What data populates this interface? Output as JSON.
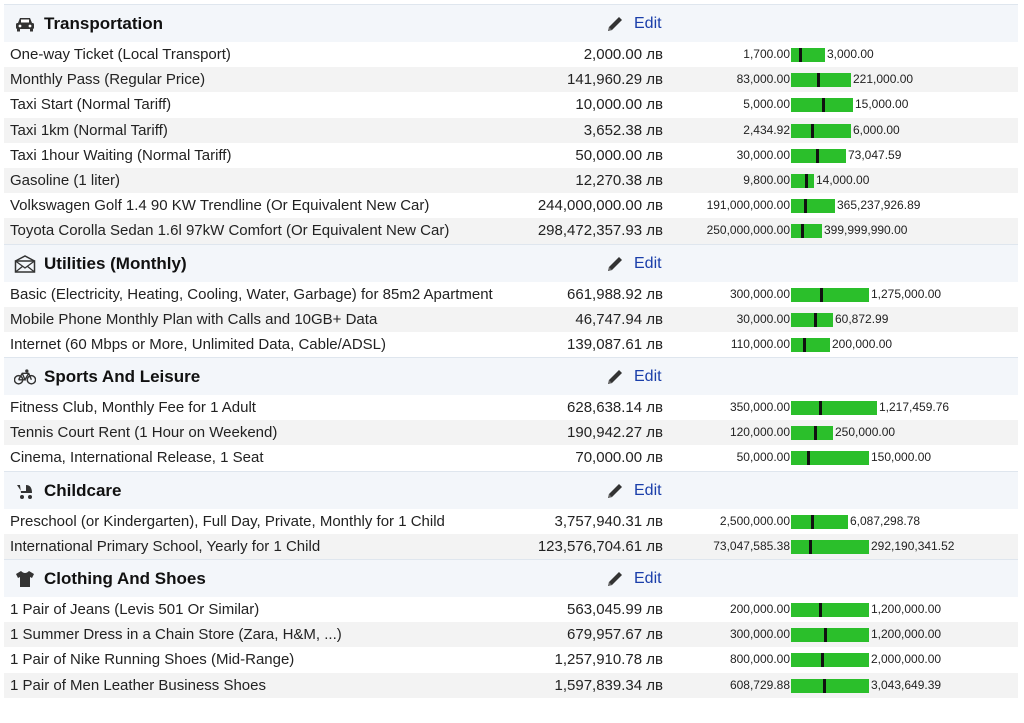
{
  "edit_label": "Edit",
  "colors": {
    "bar": "#2bbf2b",
    "edit_link": "#1a3eaa",
    "header_bg": "#f3f6fa"
  },
  "sections": [
    {
      "title": "Transportation",
      "icon": "car-icon",
      "rows": [
        {
          "name": "One-way Ticket (Local Transport)",
          "price": "2,000.00 лв",
          "min": "1,700.00",
          "max": "3,000.00",
          "bar_fraction": 0.13,
          "mark_fraction": 0.23
        },
        {
          "name": "Monthly Pass (Regular Price)",
          "price": "141,960.29 лв",
          "min": "83,000.00",
          "max": "221,000.00",
          "bar_fraction": 0.23,
          "mark_fraction": 0.43
        },
        {
          "name": "Taxi Start (Normal Tariff)",
          "price": "10,000.00 лв",
          "min": "5,000.00",
          "max": "15,000.00",
          "bar_fraction": 0.24,
          "mark_fraction": 0.5
        },
        {
          "name": "Taxi 1km (Normal Tariff)",
          "price": "3,652.38 лв",
          "min": "2,434.92",
          "max": "6,000.00",
          "bar_fraction": 0.23,
          "mark_fraction": 0.34
        },
        {
          "name": "Taxi 1hour Waiting (Normal Tariff)",
          "price": "50,000.00 лв",
          "min": "30,000.00",
          "max": "73,047.59",
          "bar_fraction": 0.21,
          "mark_fraction": 0.46
        },
        {
          "name": "Gasoline (1 liter)",
          "price": "12,270.38 лв",
          "min": "9,800.00",
          "max": "14,000.00",
          "bar_fraction": 0.09,
          "mark_fraction": 0.59
        },
        {
          "name": "Volkswagen Golf 1.4 90 KW Trendline (Or Equivalent New Car)",
          "price": "244,000,000.00 лв",
          "min": "191,000,000.00",
          "max": "365,237,926.89",
          "bar_fraction": 0.17,
          "mark_fraction": 0.3
        },
        {
          "name": "Toyota Corolla Sedan 1.6l 97kW Comfort (Or Equivalent New Car)",
          "price": "298,472,357.93 лв",
          "min": "250,000,000.00",
          "max": "399,999,990.00",
          "bar_fraction": 0.12,
          "mark_fraction": 0.32
        }
      ]
    },
    {
      "title": "Utilities (Monthly)",
      "icon": "envelope-icon",
      "rows": [
        {
          "name": "Basic (Electricity, Heating, Cooling, Water, Garbage) for 85m2 Apartment",
          "price": "661,988.92 лв",
          "min": "300,000.00",
          "max": "1,275,000.00",
          "bar_fraction": 0.3,
          "mark_fraction": 0.37
        },
        {
          "name": "Mobile Phone Monthly Plan with Calls and 10GB+ Data",
          "price": "46,747.94 лв",
          "min": "30,000.00",
          "max": "60,872.99",
          "bar_fraction": 0.16,
          "mark_fraction": 0.54
        },
        {
          "name": "Internet (60 Mbps or More, Unlimited Data, Cable/ADSL)",
          "price": "139,087.61 лв",
          "min": "110,000.00",
          "max": "200,000.00",
          "bar_fraction": 0.15,
          "mark_fraction": 0.32
        }
      ]
    },
    {
      "title": "Sports And Leisure",
      "icon": "bicycle-icon",
      "rows": [
        {
          "name": "Fitness Club, Monthly Fee for 1 Adult",
          "price": "628,638.14 лв",
          "min": "350,000.00",
          "max": "1,217,459.76",
          "bar_fraction": 0.33,
          "mark_fraction": 0.32
        },
        {
          "name": "Tennis Court Rent (1 Hour on Weekend)",
          "price": "190,942.27 лв",
          "min": "120,000.00",
          "max": "250,000.00",
          "bar_fraction": 0.16,
          "mark_fraction": 0.55
        },
        {
          "name": "Cinema, International Release, 1 Seat",
          "price": "70,000.00 лв",
          "min": "50,000.00",
          "max": "150,000.00",
          "bar_fraction": 0.3,
          "mark_fraction": 0.2
        }
      ]
    },
    {
      "title": "Childcare",
      "icon": "stroller-icon",
      "rows": [
        {
          "name": "Preschool (or Kindergarten), Full Day, Private, Monthly for 1 Child",
          "price": "3,757,940.31 лв",
          "min": "2,500,000.00",
          "max": "6,087,298.78",
          "bar_fraction": 0.22,
          "mark_fraction": 0.35
        },
        {
          "name": "International Primary School, Yearly for 1 Child",
          "price": "123,576,704.61 лв",
          "min": "73,047,585.38",
          "max": "292,190,341.52",
          "bar_fraction": 0.3,
          "mark_fraction": 0.23
        }
      ]
    },
    {
      "title": "Clothing And Shoes",
      "icon": "shirt-icon",
      "rows": [
        {
          "name": "1 Pair of Jeans (Levis 501 Or Similar)",
          "price": "563,045.99 лв",
          "min": "200,000.00",
          "max": "1,200,000.00",
          "bar_fraction": 0.3,
          "mark_fraction": 0.36
        },
        {
          "name": "1 Summer Dress in a Chain Store (Zara, H&M, ...)",
          "price": "679,957.67 лв",
          "min": "300,000.00",
          "max": "1,200,000.00",
          "bar_fraction": 0.3,
          "mark_fraction": 0.42
        },
        {
          "name": "1 Pair of Nike Running Shoes (Mid-Range)",
          "price": "1,257,910.78 лв",
          "min": "800,000.00",
          "max": "2,000,000.00",
          "bar_fraction": 0.3,
          "mark_fraction": 0.38
        },
        {
          "name": "1 Pair of Men Leather Business Shoes",
          "price": "1,597,839.34 лв",
          "min": "608,729.88",
          "max": "3,043,649.39",
          "bar_fraction": 0.3,
          "mark_fraction": 0.41
        }
      ]
    }
  ]
}
